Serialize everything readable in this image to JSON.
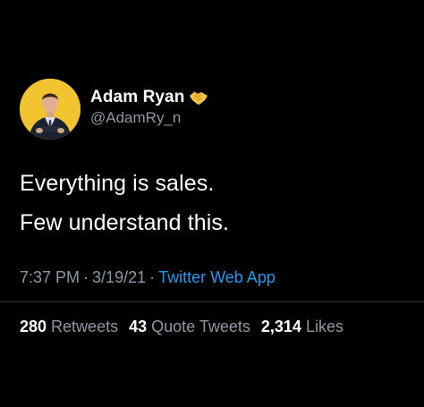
{
  "author": {
    "display_name": "Adam Ryan",
    "handle": "@AdamRy_n",
    "badge_icon": "handshake-icon",
    "avatar_bg": "#f2c530"
  },
  "tweet": {
    "lines": [
      "Everything is sales.",
      "Few understand this."
    ],
    "time": "7:37 PM",
    "date": "3/19/21",
    "separator": "·",
    "source": "Twitter Web App"
  },
  "stats": {
    "retweets_count": "280",
    "retweets_label": "Retweets",
    "quotes_count": "43",
    "quotes_label": "Quote Tweets",
    "likes_count": "2,314",
    "likes_label": "Likes"
  },
  "colors": {
    "background": "#000000",
    "text": "#ffffff",
    "secondary": "#8b98a5",
    "link": "#1d9bf0"
  }
}
